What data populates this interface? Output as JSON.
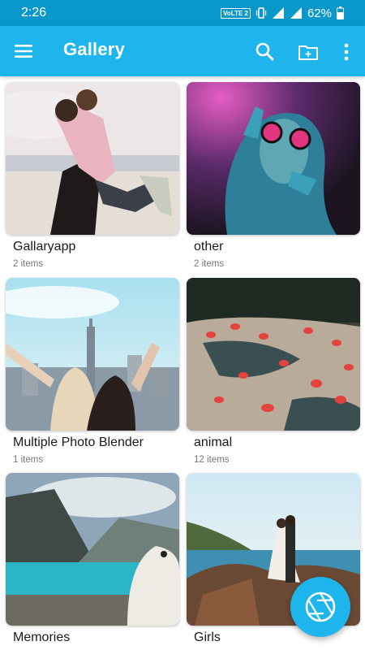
{
  "status_bar": {
    "time": "2:26",
    "network_badge": "VoLTE 2",
    "battery": "62%",
    "icons": [
      "vibrate-icon",
      "signal-icon",
      "signal-icon",
      "battery-icon"
    ]
  },
  "app_bar": {
    "title": "Gallery",
    "background": "#1eb4ec",
    "icons": [
      "menu-icon",
      "search-icon",
      "new-folder-icon",
      "more-vert-icon"
    ]
  },
  "albums": [
    {
      "name": "Gallaryapp",
      "count": "2 items"
    },
    {
      "name": "other",
      "count": "2 items"
    },
    {
      "name": "Multiple Photo Blender",
      "count": "1 items"
    },
    {
      "name": "animal",
      "count": "12 items"
    },
    {
      "name": "Memories",
      "count": ""
    },
    {
      "name": "Girls",
      "count": ""
    }
  ],
  "fab": {
    "icon": "camera-aperture-icon"
  }
}
